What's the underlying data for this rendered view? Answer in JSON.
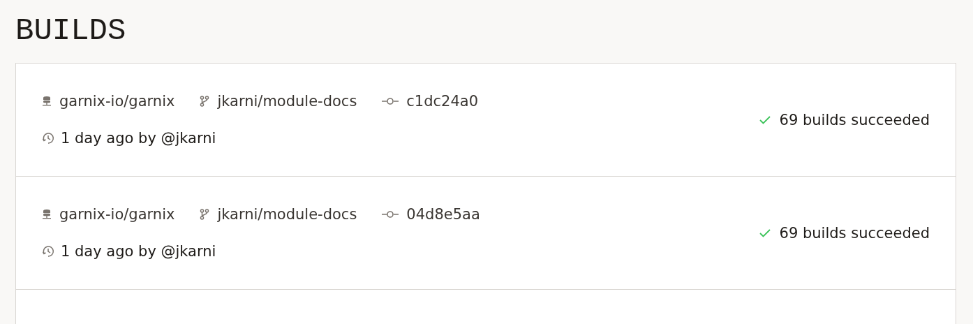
{
  "page": {
    "title": "BUILDS"
  },
  "builds": [
    {
      "repo": "garnix-io/garnix",
      "branch": "jkarni/module-docs",
      "commit": "c1dc24a0",
      "time": "1 day ago by @jkarni",
      "succeeded": true,
      "summary": "69 builds succeeded"
    },
    {
      "repo": "garnix-io/garnix",
      "branch": "jkarni/module-docs",
      "commit": "04d8e5aa",
      "time": "1 day ago by @jkarni",
      "succeeded": true,
      "summary": "69 builds succeeded"
    }
  ]
}
